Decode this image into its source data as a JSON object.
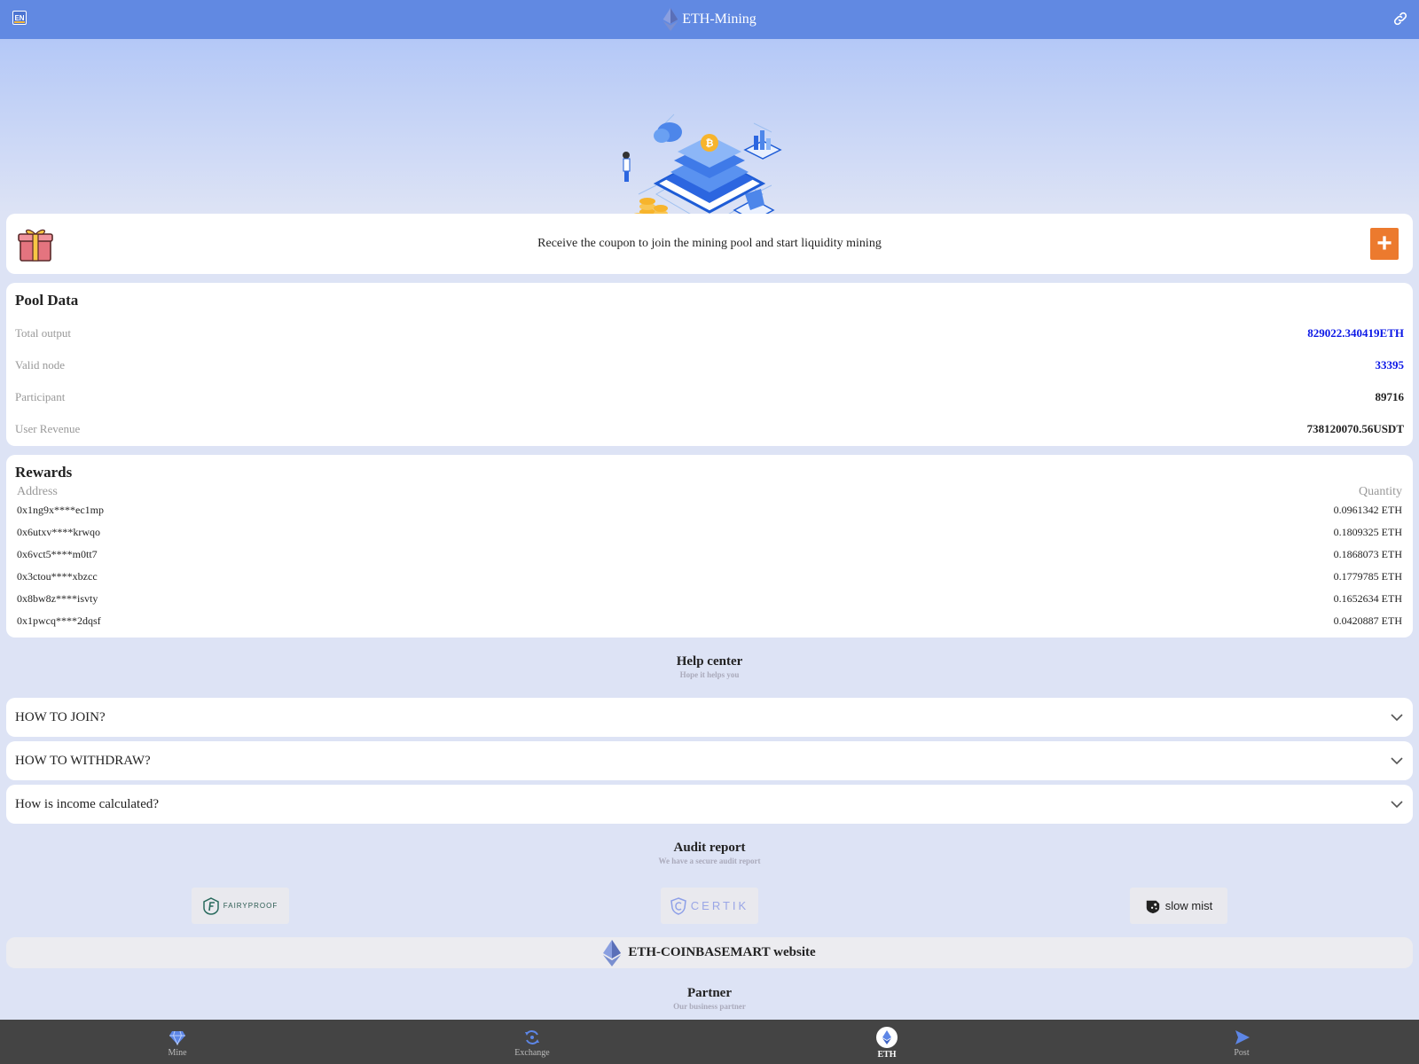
{
  "header": {
    "lang": "EN",
    "title": "ETH-Mining"
  },
  "coupon": {
    "text": "Receive the coupon to join the mining pool and start liquidity mining",
    "plus": "+"
  },
  "pool": {
    "title": "Pool Data",
    "rows": [
      {
        "label": "Total output",
        "value": "829022.340419ETH"
      },
      {
        "label": "Valid node",
        "value": "33395"
      },
      {
        "label": "Participant",
        "value": "89716"
      },
      {
        "label": "User Revenue",
        "value": "738120070.56USDT"
      }
    ]
  },
  "rewards": {
    "title": "Rewards",
    "col_address": "Address",
    "col_quantity": "Quantity",
    "rows": [
      {
        "address": "0x1ng9x****ec1mp",
        "quantity": "0.0961342 ETH"
      },
      {
        "address": "0x6utxv****krwqo",
        "quantity": "0.1809325 ETH"
      },
      {
        "address": "0x6vct5****m0tt7",
        "quantity": "0.1868073 ETH"
      },
      {
        "address": "0x3ctou****xbzcc",
        "quantity": "0.1779785 ETH"
      },
      {
        "address": "0x8bw8z****isvty",
        "quantity": "0.1652634 ETH"
      },
      {
        "address": "0x1pwcq****2dqsf",
        "quantity": "0.0420887 ETH"
      }
    ]
  },
  "help": {
    "title": "Help center",
    "subtitle": "Hope it helps you",
    "faqs": [
      {
        "q": "HOW TO JOIN?"
      },
      {
        "q": "HOW TO WITHDRAW?"
      },
      {
        "q": "How is income calculated?"
      }
    ]
  },
  "audit": {
    "title": "Audit report",
    "subtitle": "We have a secure audit report",
    "logos": [
      "FAIRYPROOF",
      "CERTIK",
      "slow mist"
    ]
  },
  "website": {
    "label": "ETH-COINBASEMART website"
  },
  "partner": {
    "title": "Partner",
    "subtitle": "Our business partner"
  },
  "nav": {
    "items": [
      {
        "label": "Mine",
        "icon": "diamond-icon"
      },
      {
        "label": "Exchange",
        "icon": "exchange-icon"
      },
      {
        "label": "ETH",
        "icon": "eth-icon"
      },
      {
        "label": "Post",
        "icon": "send-icon"
      }
    ],
    "active": 2
  },
  "colors": {
    "header": "#6189e2",
    "accent_blue": "#0b17e6",
    "coupon_button": "#ec7a2e",
    "nav_bg": "#444444"
  }
}
